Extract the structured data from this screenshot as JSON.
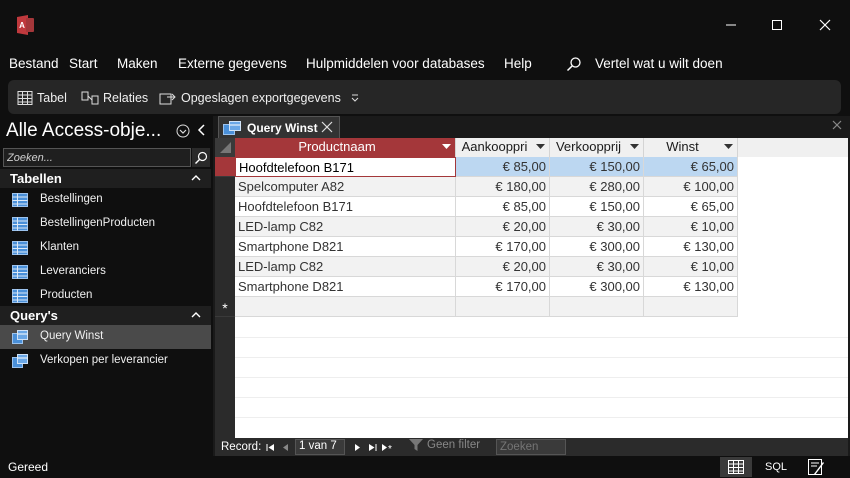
{
  "menu": {
    "items": [
      "Bestand",
      "Start",
      "Maken",
      "Externe gegevens",
      "Hulpmiddelen voor databases",
      "Help"
    ],
    "tell_me": "Vertel wat u wilt doen"
  },
  "ribbon": {
    "table_label": "Tabel",
    "relations_label": "Relaties",
    "saved_exports_label": "Opgeslagen exportgegevens"
  },
  "nav": {
    "title": "Alle Access-obje...",
    "search_placeholder": "Zoeken...",
    "groups": [
      {
        "label": "Tabellen",
        "items": [
          "Bestellingen",
          "BestellingenProducten",
          "Klanten",
          "Leveranciers",
          "Producten"
        ]
      },
      {
        "label": "Query's",
        "items": [
          "Query Winst",
          "Verkopen per leverancier"
        ]
      }
    ],
    "selected_item": "Query Winst"
  },
  "document": {
    "tab_label": "Query Winst",
    "columns": [
      "Productnaam",
      "Aankooppri",
      "Verkoopprij",
      "Winst"
    ],
    "rows": [
      [
        "Hoofdtelefoon B171",
        "€ 85,00",
        "€ 150,00",
        "€ 65,00"
      ],
      [
        "Spelcomputer A82",
        "€ 180,00",
        "€ 280,00",
        "€ 100,00"
      ],
      [
        "Hoofdtelefoon B171",
        "€ 85,00",
        "€ 150,00",
        "€ 65,00"
      ],
      [
        "LED-lamp C82",
        "€ 20,00",
        "€ 30,00",
        "€ 10,00"
      ],
      [
        "Smartphone D821",
        "€ 170,00",
        "€ 300,00",
        "€ 130,00"
      ],
      [
        "LED-lamp C82",
        "€ 20,00",
        "€ 30,00",
        "€ 10,00"
      ],
      [
        "Smartphone D821",
        "€ 170,00",
        "€ 300,00",
        "€ 130,00"
      ]
    ],
    "new_row_marker": "*"
  },
  "record_nav": {
    "label": "Record:",
    "position": "1 van 7",
    "filter_label": "Geen filter",
    "search_placeholder": "Zoeken"
  },
  "status": {
    "text": "Gereed",
    "sql_label": "SQL"
  },
  "colors": {
    "accent": "#a4373a",
    "selected_row": "#bcd7f1",
    "grid_bg": "#ffffff"
  }
}
